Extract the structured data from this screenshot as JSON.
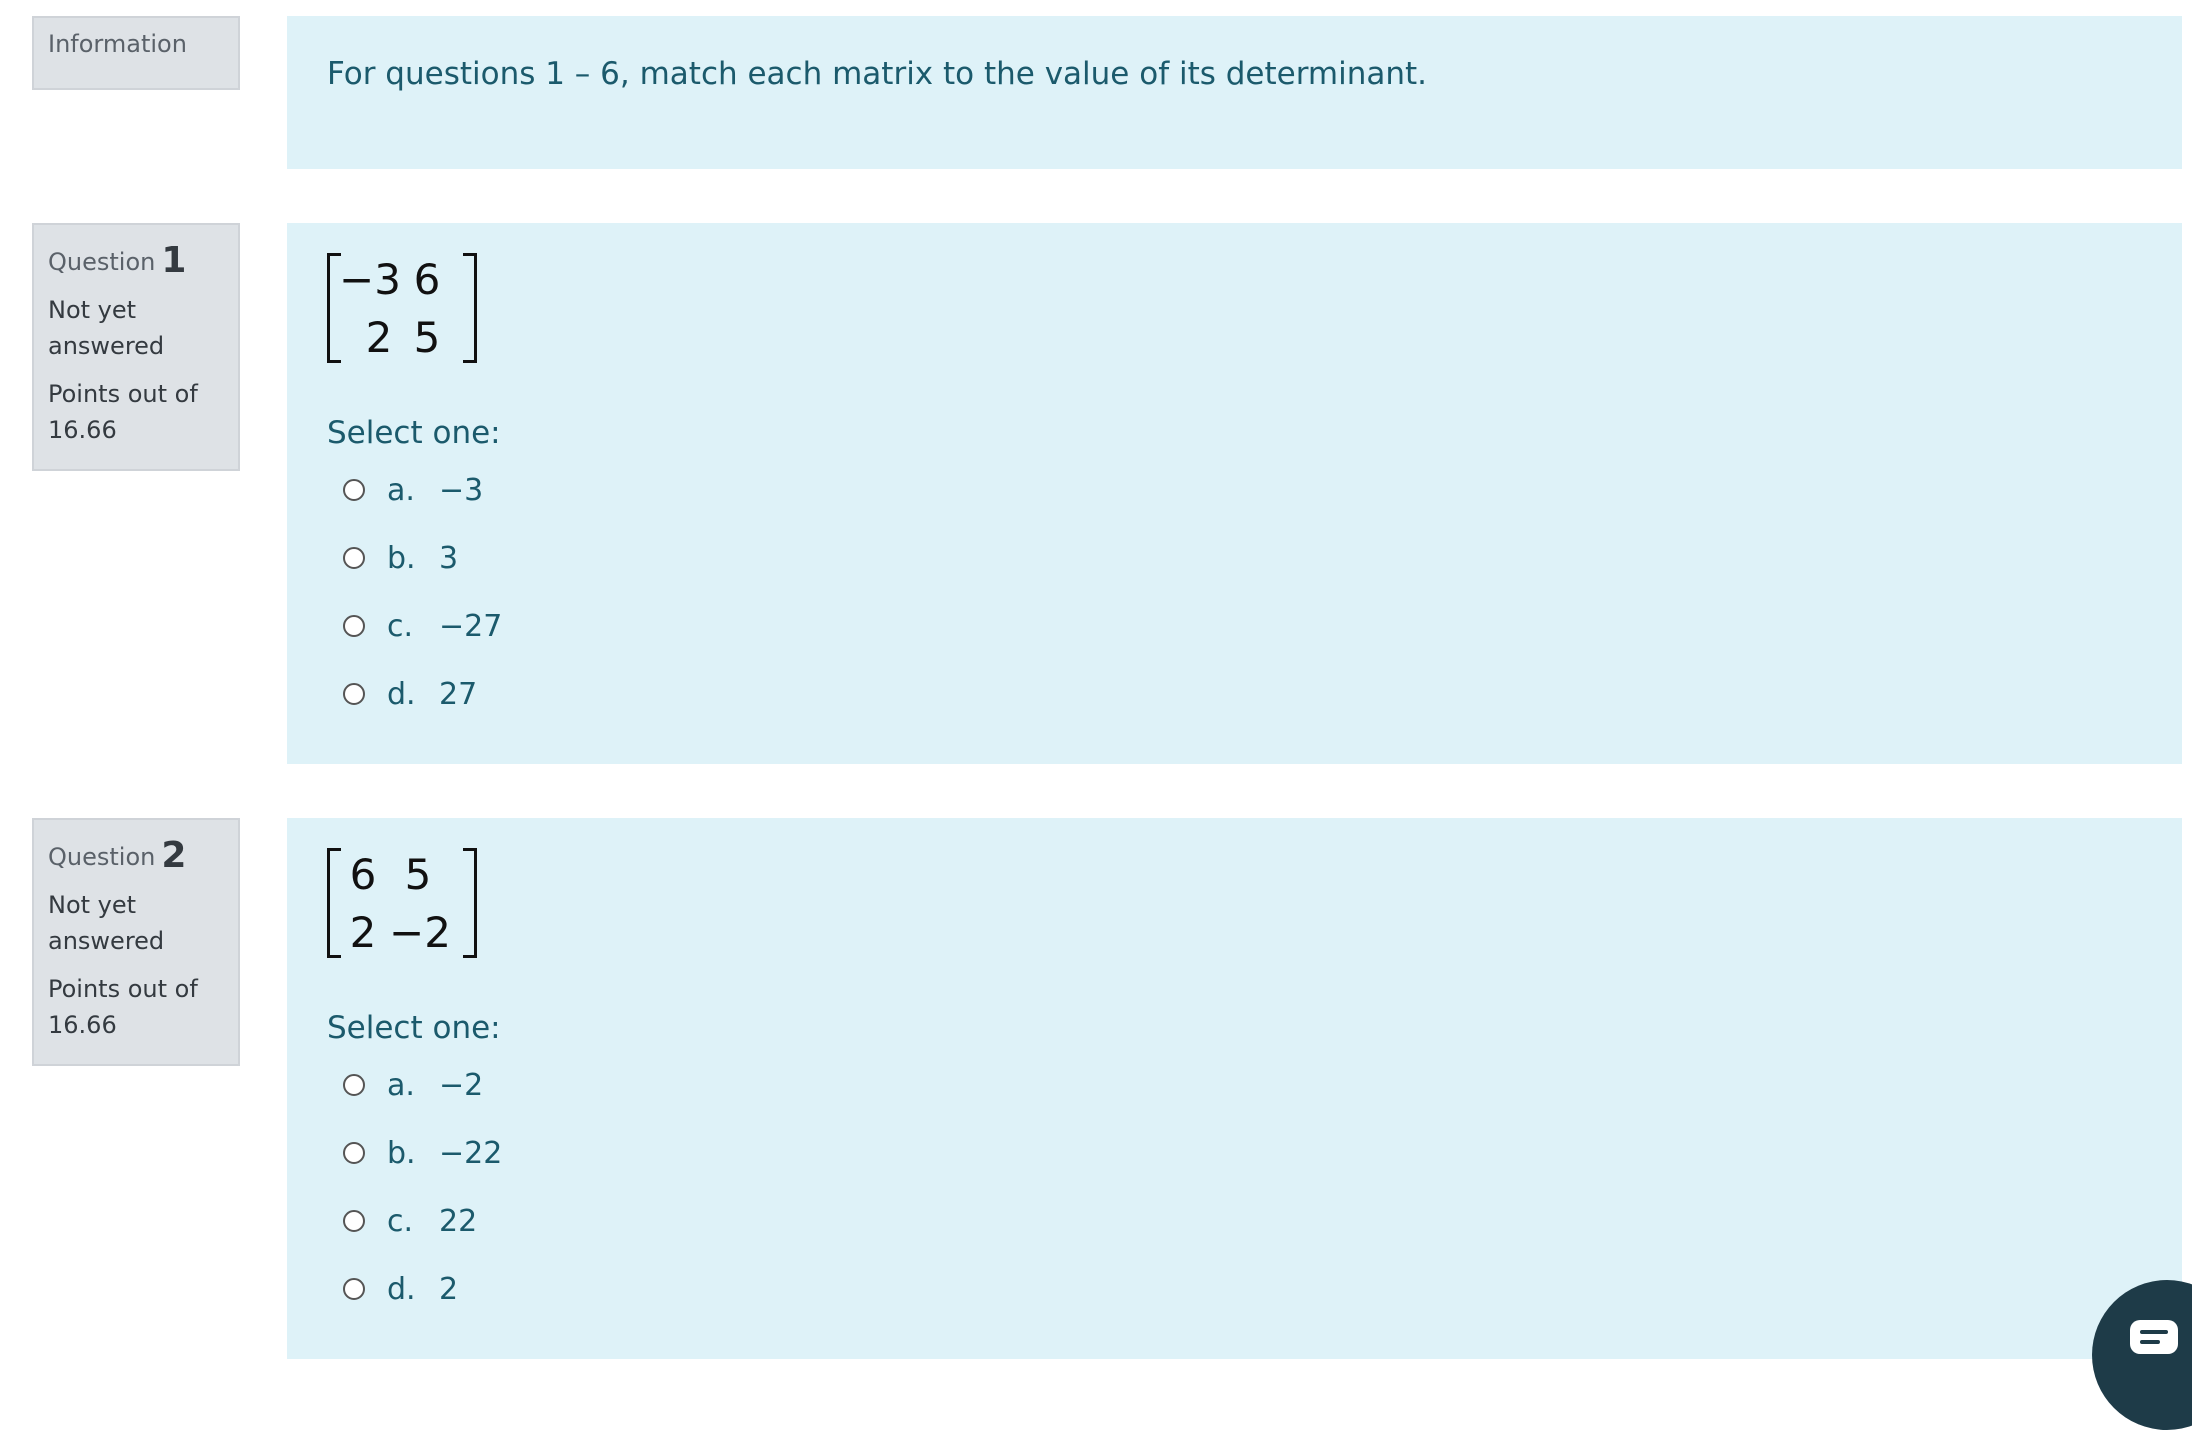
{
  "information": {
    "label": "Information",
    "text": "For questions 1 – 6, match each matrix to the value of its determinant."
  },
  "questions": [
    {
      "label": "Question",
      "number": "1",
      "state": "Not yet answered",
      "grade": "Points out of 16.66",
      "matrix": [
        [
          "−3",
          "6"
        ],
        [
          "2",
          "5"
        ]
      ],
      "prompt": "Select one:",
      "options": [
        {
          "letter": "a.",
          "value": "−3"
        },
        {
          "letter": "b.",
          "value": "3"
        },
        {
          "letter": "c.",
          "value": "−27"
        },
        {
          "letter": "d.",
          "value": "27"
        }
      ]
    },
    {
      "label": "Question",
      "number": "2",
      "state": "Not yet answered",
      "grade": "Points out of 16.66",
      "matrix": [
        [
          "6",
          "5"
        ],
        [
          "2",
          "−2"
        ]
      ],
      "prompt": "Select one:",
      "options": [
        {
          "letter": "a.",
          "value": "−2"
        },
        {
          "letter": "b.",
          "value": "−22"
        },
        {
          "letter": "c.",
          "value": "22"
        },
        {
          "letter": "d.",
          "value": "2"
        }
      ]
    }
  ],
  "chat_widget": {
    "icon": "chat-bubble-icon"
  }
}
